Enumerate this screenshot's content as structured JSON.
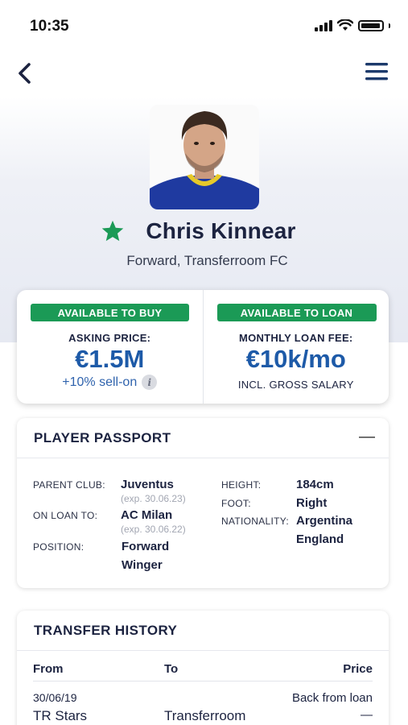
{
  "status_bar": {
    "time": "10:35"
  },
  "nav": {
    "back_icon": "chevron-left-icon",
    "menu_icon": "hamburger-menu-icon"
  },
  "player": {
    "name": "Chris Kinnear",
    "subtitle": "Forward, Transferroom FC",
    "favourite_icon": "star-icon",
    "favourite_color": "#1b9a56"
  },
  "pricing": {
    "buy": {
      "badge": "AVAILABLE TO BUY",
      "label": "ASKING PRICE:",
      "amount": "€1.5M",
      "note": "+10% sell-on",
      "info_icon": "i"
    },
    "loan": {
      "badge": "AVAILABLE TO LOAN",
      "label": "MONTHLY LOAN FEE:",
      "amount": "€10k/mo",
      "note": "INCL. GROSS SALARY"
    }
  },
  "passport": {
    "title": "PLAYER PASSPORT",
    "collapse": "—",
    "parent_club_label": "PARENT CLUB:",
    "parent_club": "Juventus",
    "parent_club_exp": "(exp. 30.06.23)",
    "on_loan_label": "ON LOAN TO:",
    "on_loan": "AC Milan",
    "on_loan_exp": "(exp. 30.06.22)",
    "position_label": "POSITION:",
    "positions": [
      "Forward",
      "Winger"
    ],
    "height_label": "HEIGHT:",
    "height": "184cm",
    "foot_label": "FOOT:",
    "foot": "Right",
    "nationality_label": "NATIONALITY:",
    "nationalities": [
      "Argentina",
      "England"
    ]
  },
  "transfer_history": {
    "title": "TRANSFER HISTORY",
    "columns": {
      "from": "From",
      "to": "To",
      "price": "Price"
    },
    "rows": [
      {
        "date": "30/06/19",
        "from": "TR Stars",
        "to": "Transferroom",
        "note": "Back from loan",
        "price": "—"
      }
    ]
  },
  "colors": {
    "accent_green": "#1b9a56",
    "accent_blue": "#1d5aa8",
    "navy": "#1c2340"
  }
}
